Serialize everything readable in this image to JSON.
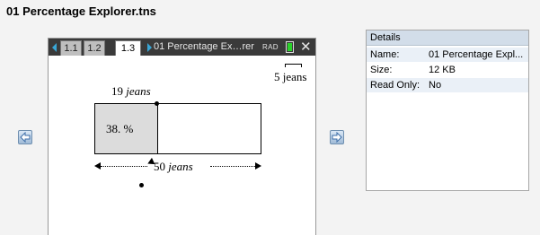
{
  "file_title": "01 Percentage Explorer.tns",
  "tabs": [
    {
      "label": "1.1",
      "active": false
    },
    {
      "label": "1.2",
      "active": false
    },
    {
      "label": "1.3",
      "active": true
    }
  ],
  "document_title": "01 Percentage Ex…rer",
  "angle_mode": "RAD",
  "canvas": {
    "scale_label": "5 jeans",
    "part_value": "19",
    "part_unit": "jeans",
    "percent_label": "38.  %",
    "percent": 38,
    "whole_value": "50",
    "whole_unit": "jeans"
  },
  "details": {
    "header": "Details",
    "rows": [
      {
        "key": "Name:",
        "value": "01 Percentage Expl..."
      },
      {
        "key": "Size:",
        "value": "12 KB"
      },
      {
        "key": "Read Only:",
        "value": "No"
      }
    ]
  },
  "icons": {
    "prev": "arrow-left-icon",
    "next": "arrow-right-icon",
    "close": "close-icon",
    "battery": "battery-icon"
  },
  "colors": {
    "tab_accent": "#39a6d6",
    "battery": "#2bd12b",
    "details_header": "#d2dde9"
  }
}
